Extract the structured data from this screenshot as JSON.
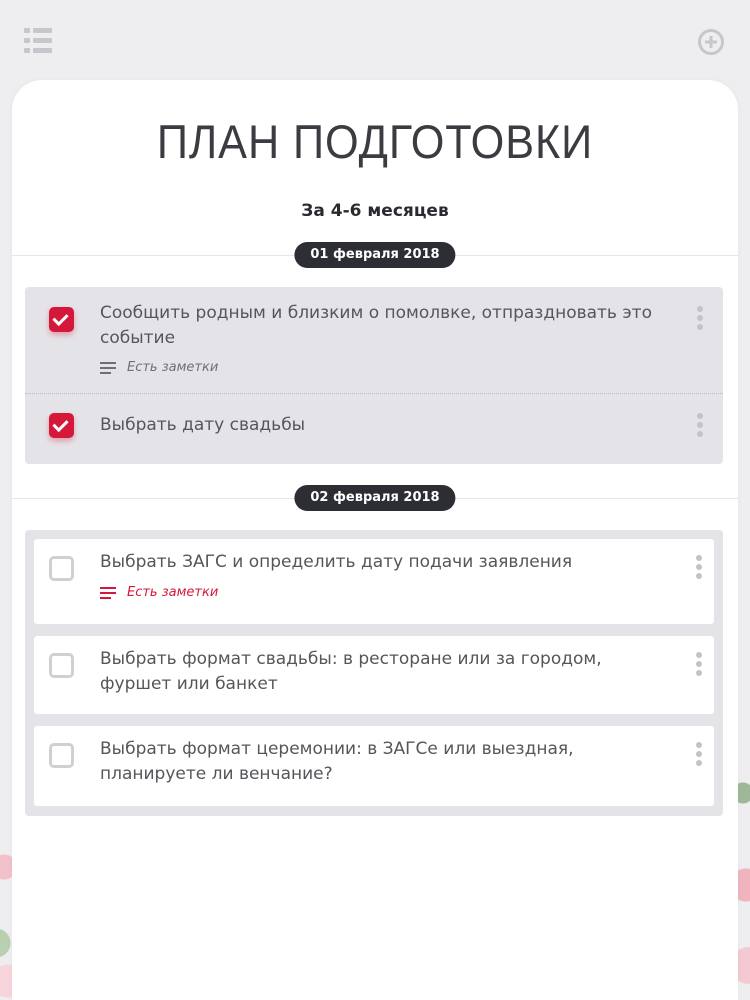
{
  "header": {
    "menu_icon": "list-menu-icon",
    "add_icon": "plus-circle-icon"
  },
  "page": {
    "title": "ПЛАН ПОДГОТОВКИ",
    "period": "За 4-6 месяцев"
  },
  "groups": [
    {
      "date": "01 февраля 2018",
      "tasks": [
        {
          "text": "Сообщить родным и близким о помолвке, отпраздновать это событие",
          "checked": true,
          "notes": "Есть заметки"
        },
        {
          "text": "Выбрать дату свадьбы",
          "checked": true
        }
      ]
    },
    {
      "date": "02 февраля 2018",
      "tasks": [
        {
          "text": "Выбрать ЗАГС и определить дату подачи заявления",
          "checked": false,
          "notes": "Есть заметки"
        },
        {
          "text": "Выбрать формат свадьбы: в ресторане или за городом, фуршет или банкет",
          "checked": false
        },
        {
          "text": "Выбрать формат церемонии: в ЗАГСе или выездная, планируете ли венчание?",
          "checked": false
        }
      ]
    }
  ],
  "colors": {
    "accent": "#d5183a",
    "pill": "#2d2e33",
    "text": "#55565b"
  }
}
